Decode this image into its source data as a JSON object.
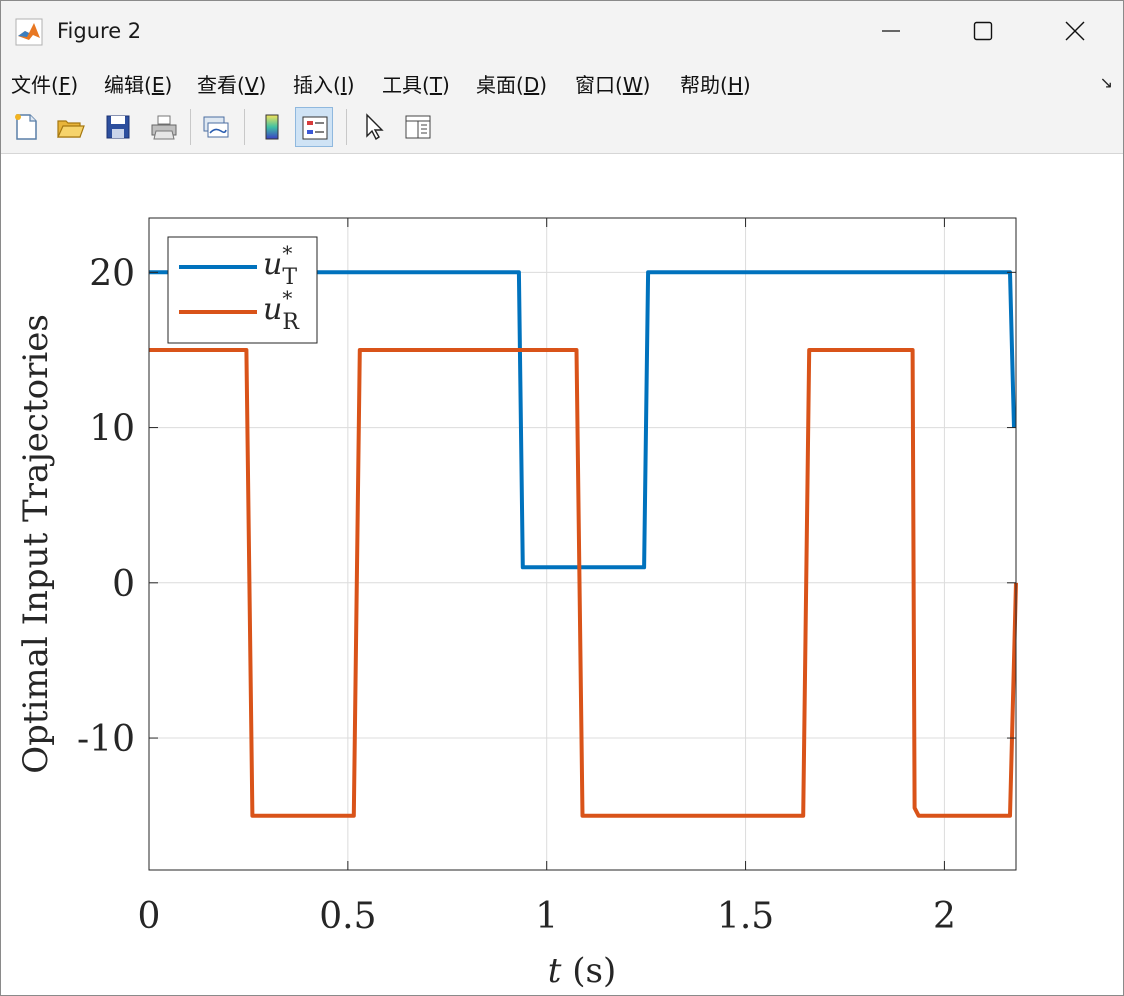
{
  "window": {
    "title": "Figure 2",
    "minimize_glyph": "minimize",
    "maximize_glyph": "maximize",
    "close_glyph": "close"
  },
  "menu": [
    {
      "label": "文件(",
      "acc": "F",
      "tail": ")"
    },
    {
      "label": "编辑(",
      "acc": "E",
      "tail": ")"
    },
    {
      "label": "查看(",
      "acc": "V",
      "tail": ")"
    },
    {
      "label": "插入(",
      "acc": "I",
      "tail": ")"
    },
    {
      "label": "工具(",
      "acc": "T",
      "tail": ")"
    },
    {
      "label": "桌面(",
      "acc": "D",
      "tail": ")"
    },
    {
      "label": "窗口(",
      "acc": "W",
      "tail": ")"
    },
    {
      "label": "帮助(",
      "acc": "H",
      "tail": ")"
    }
  ],
  "toolbar": {
    "icons": [
      "new-figure-icon",
      "open-file-icon",
      "save-icon",
      "print-icon",
      "link-plot-icon",
      "colorbar-icon",
      "legend-icon",
      "pointer-icon",
      "property-inspector-icon"
    ]
  },
  "colors": {
    "series1": "#0072BD",
    "series2": "#D95319"
  },
  "chart_data": {
    "type": "line",
    "xlabel_var": "t",
    "xlabel_unit": "(s)",
    "ylabel": "Optimal Input Trajectories",
    "xlim": [
      0,
      2.18
    ],
    "ylim": [
      -18.5,
      23.5
    ],
    "xticks": [
      0,
      0.5,
      1,
      1.5,
      2
    ],
    "xtick_labels": [
      "0",
      "0.5",
      "1",
      "1.5",
      "2"
    ],
    "yticks": [
      -10,
      0,
      10,
      20
    ],
    "ytick_labels": [
      "-10",
      "0",
      "10",
      "20"
    ],
    "grid": true,
    "legend_placement": "top-left",
    "series": [
      {
        "name_base": "u",
        "name_sup": "*",
        "name_sub": "T",
        "x": [
          0,
          0.93,
          0.94,
          1.245,
          1.255,
          2.165,
          2.175
        ],
        "y": [
          20,
          20,
          1,
          1,
          20,
          20,
          10
        ]
      },
      {
        "name_base": "u",
        "name_sup": "*",
        "name_sub": "R",
        "x": [
          0,
          0.245,
          0.26,
          0.515,
          0.53,
          1.075,
          1.09,
          1.645,
          1.66,
          1.92,
          1.925,
          1.935,
          2.165,
          2.18
        ],
        "y": [
          15,
          15,
          -15,
          -15,
          15,
          15,
          -15,
          -15,
          15,
          15,
          -14.5,
          -15,
          -15,
          0
        ]
      }
    ]
  }
}
